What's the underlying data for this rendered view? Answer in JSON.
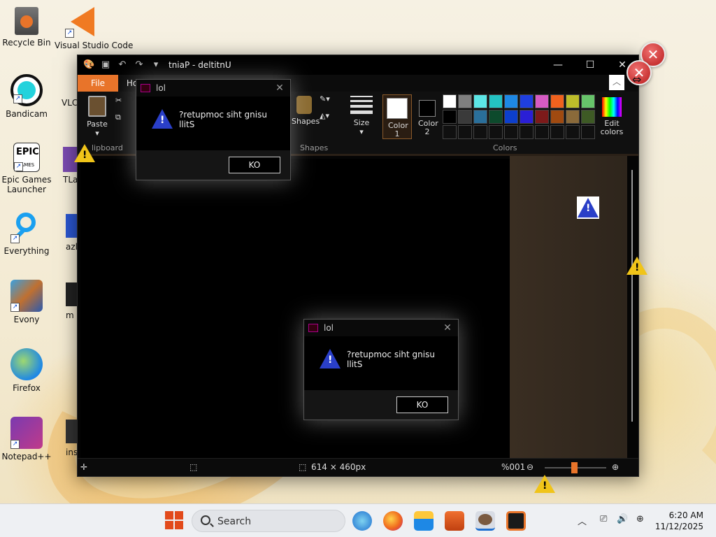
{
  "desktop": {
    "icons": [
      {
        "label": "Recycle Bin"
      },
      {
        "label": "Visual Studio Code"
      },
      {
        "label": "Bandicam"
      },
      {
        "label": "VLC media player"
      },
      {
        "label": "Epic Games Launcher"
      },
      {
        "label": "TLauncher"
      },
      {
        "label": "Everything"
      },
      {
        "label": "azl"
      },
      {
        "label": "Evony"
      },
      {
        "label": "m"
      },
      {
        "label": "Firefox"
      },
      {
        "label": "Notepad++"
      },
      {
        "label": "ins"
      }
    ]
  },
  "paint": {
    "title": "tniaP - deltitnU",
    "tabs": {
      "file": "File",
      "home": "Ho"
    },
    "ribbon": {
      "paste": "Paste",
      "clipboard": "lipboard",
      "shapes": "Shapes",
      "shapes_group": "Shapes",
      "size": "Size",
      "color1": "Color 1",
      "color2": "Color 2",
      "colors_group": "Colors",
      "edit_colors": "Edit colors"
    },
    "palette": [
      "#ffffff",
      "#7f7f7f",
      "#5ce6e6",
      "#24c2c2",
      "#1e88e5",
      "#1f3fe0",
      "#d65bc3",
      "#f0621e",
      "#bdbd2a",
      "#67c46a",
      "#000000",
      "#3a3a3a",
      "#2a6f9a",
      "#0d4a2c",
      "#0d3fcc",
      "#2a1fd6",
      "#7d1a1a",
      "#a04a10",
      "#8a6a3a",
      "#3e5a25",
      "",
      "",
      "",
      "",
      "",
      "",
      "",
      "",
      "",
      "",
      ""
    ],
    "status": {
      "selection_size": "",
      "canvas_size": "614 × 460px",
      "zoom": "%001"
    }
  },
  "dialogs": [
    {
      "title": "lol",
      "message": "?retupmoc siht gnisu llitS",
      "ok": "KO"
    },
    {
      "title": "lol",
      "message": "?retupmoc siht gnisu llitS",
      "ok": "KO"
    }
  ],
  "taskbar": {
    "search_placeholder": "Search",
    "time": "6:20 AM",
    "date": "11/12/2025"
  }
}
